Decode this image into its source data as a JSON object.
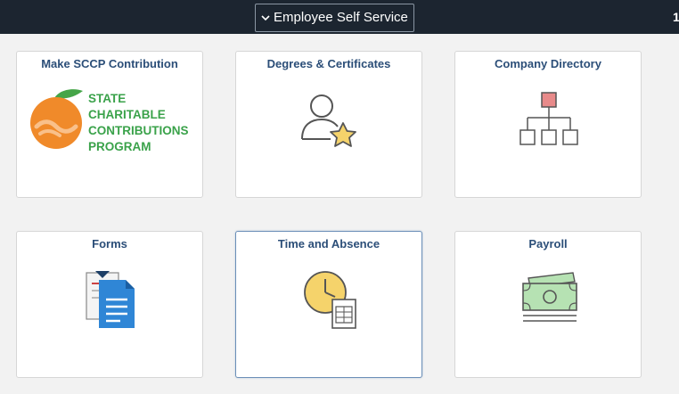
{
  "header": {
    "homepage_selector": "Employee Self Service",
    "edge_text": "1"
  },
  "tiles": [
    {
      "title": "Make SCCP Contribution",
      "icon": "sccp-logo",
      "logo_lines": [
        "STATE",
        "CHARITABLE",
        "CONTRIBUTIONS",
        "PROGRAM"
      ]
    },
    {
      "title": "Degrees & Certificates",
      "icon": "person-star-icon"
    },
    {
      "title": "Company Directory",
      "icon": "org-chart-icon"
    },
    {
      "title": "Forms",
      "icon": "documents-icon"
    },
    {
      "title": "Time and Absence",
      "icon": "clock-document-icon"
    },
    {
      "title": "Payroll",
      "icon": "money-stack-icon"
    }
  ],
  "colors": {
    "topbar": "#1c2530",
    "tile_title": "#2b4e78",
    "sccp_green": "#3aa24a",
    "sccp_orange": "#f0892a",
    "org_node_accent": "#e88a8a",
    "payroll_green": "#b6e2b3"
  }
}
